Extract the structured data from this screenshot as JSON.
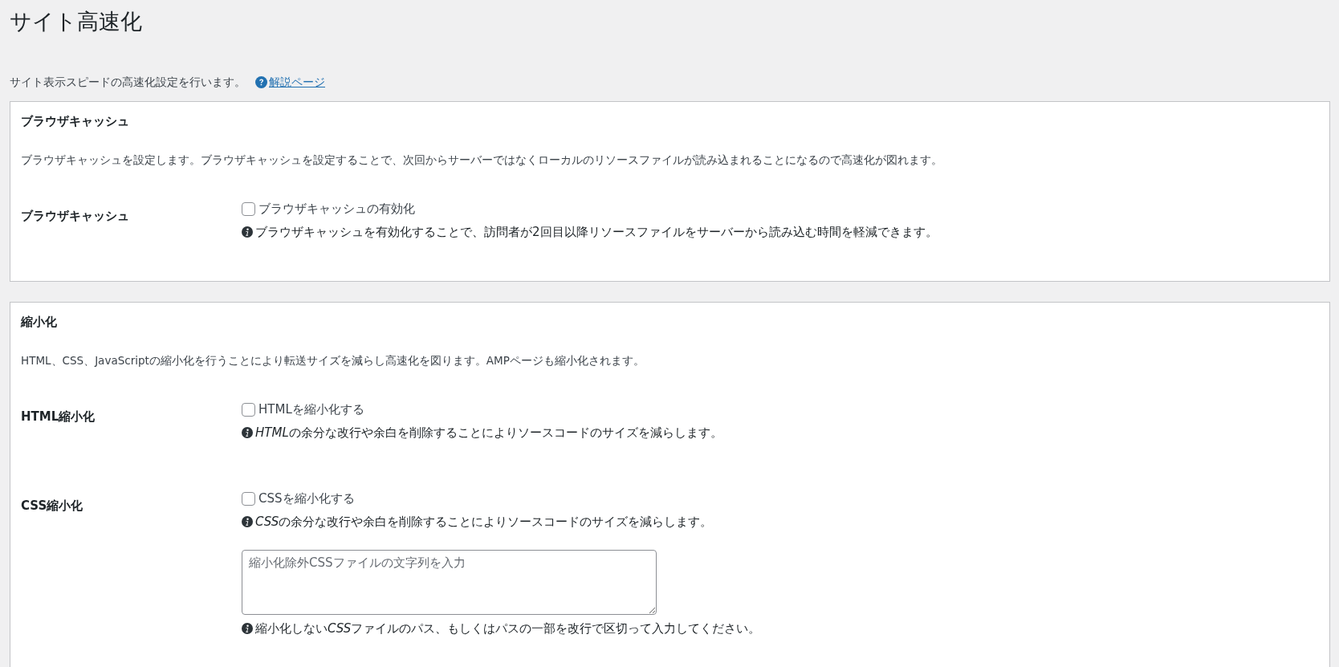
{
  "page": {
    "title": "サイト高速化",
    "intro": "サイト表示スピードの高速化設定を行います。",
    "help_link": "解説ページ"
  },
  "sections": [
    {
      "title": "ブラウザキャッシュ",
      "description": "ブラウザキャッシュを設定します。ブラウザキャッシュを設定することで、次回からサーバーではなくローカルのリソースファイルが読み込まれることになるので高速化が図れます。",
      "rows": [
        {
          "label": "ブラウザキャッシュ",
          "checkbox": {
            "label": "ブラウザキャッシュの有効化",
            "checked": false
          },
          "note": "ブラウザキャッシュを有効化することで、訪問者が2回目以降リソースファイルをサーバーから読み込む時間を軽減できます。"
        }
      ]
    },
    {
      "title": "縮小化",
      "description": "HTML、CSS、JavaScriptの縮小化を行うことにより転送サイズを減らし高速化を図ります。AMPページも縮小化されます。",
      "rows": [
        {
          "label": "HTML縮小化",
          "checkbox": {
            "label": "HTMLを縮小化する",
            "checked": false
          },
          "note": [
            {
              "text": "HTML",
              "italic": true
            },
            {
              "text": "の余分な改行や余白を削除することによりソースコードのサイズを減らします。",
              "italic": false
            }
          ]
        },
        {
          "label": "CSS縮小化",
          "checkbox": {
            "label": "CSSを縮小化する",
            "checked": false
          },
          "note": [
            {
              "text": "CSS",
              "italic": true
            },
            {
              "text": "の余分な改行や余白を削除することによりソースコードのサイズを減らします。",
              "italic": false
            }
          ],
          "textarea": {
            "placeholder": "縮小化除外CSSファイルの文字列を入力"
          },
          "textarea_note": [
            {
              "text": "縮小化しない",
              "italic": false
            },
            {
              "text": "CSS",
              "italic": true
            },
            {
              "text": "ファイルのパス、もしくはパスの一部を改行で区切って入力してください。",
              "italic": false
            }
          ]
        }
      ]
    }
  ]
}
